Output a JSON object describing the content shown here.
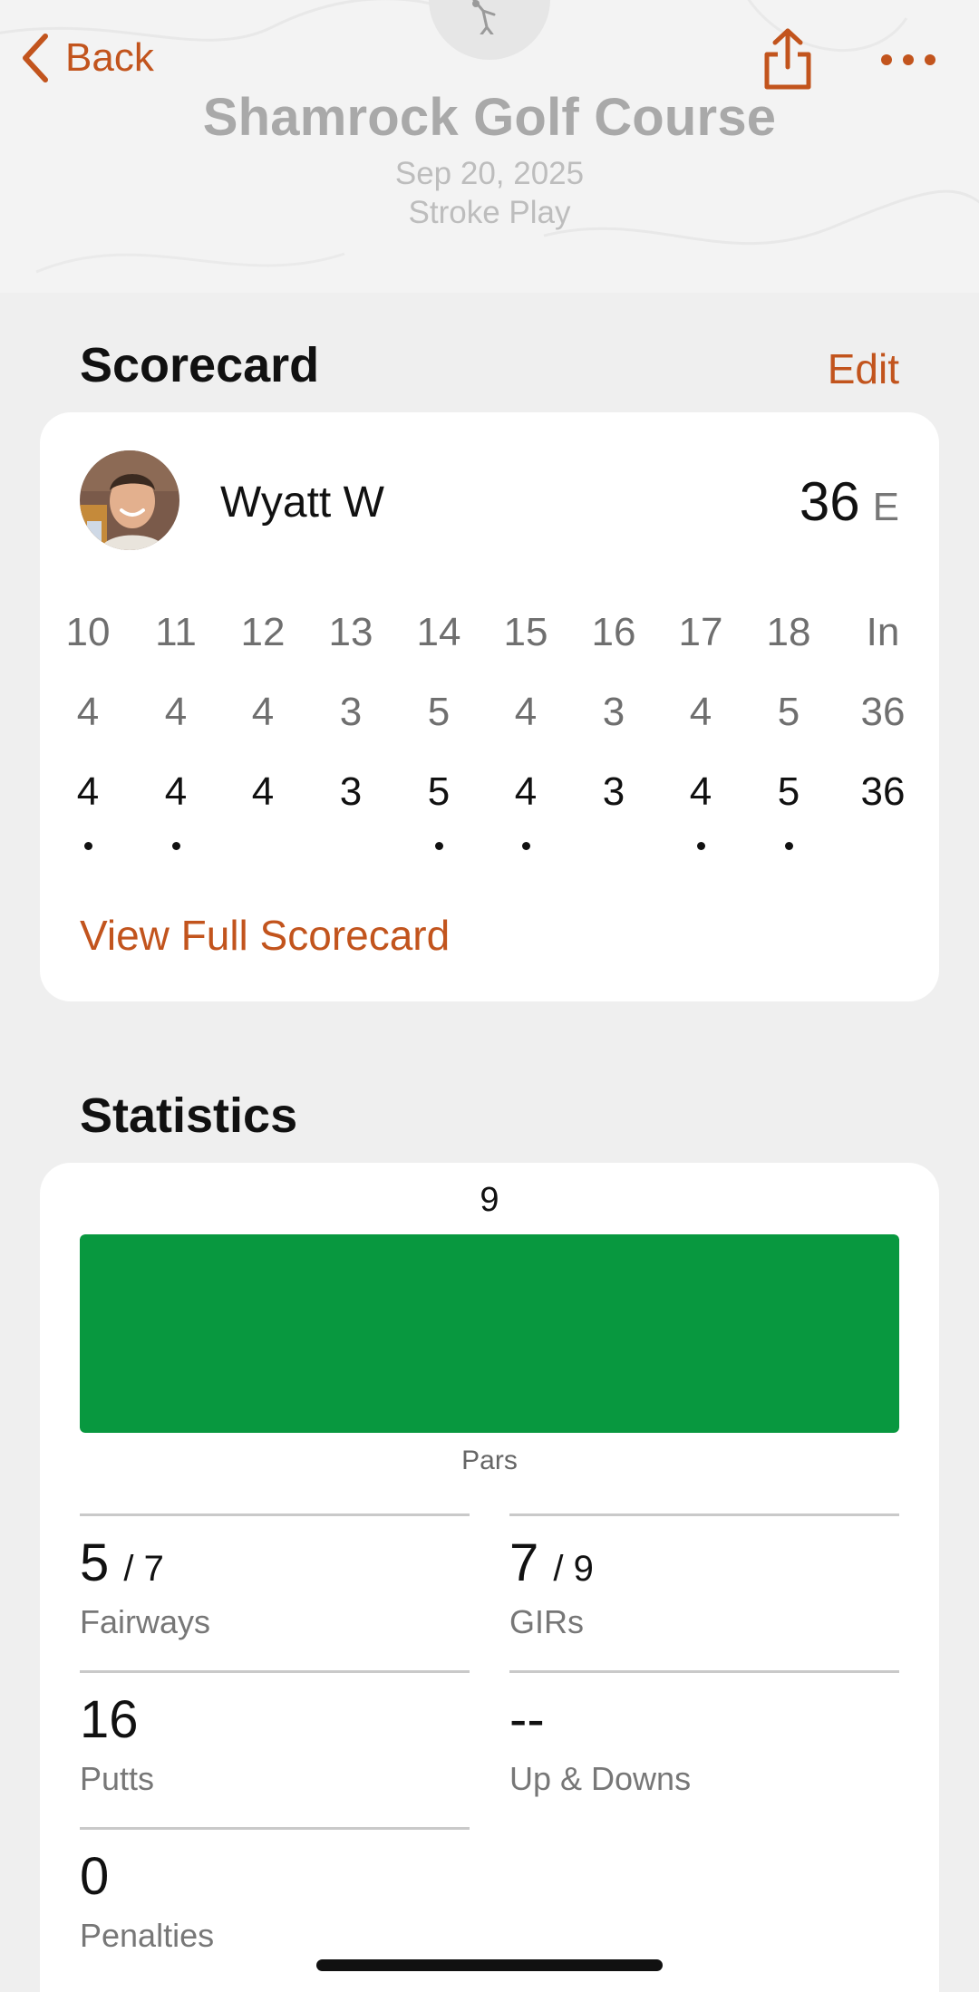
{
  "header": {
    "back_label": "Back",
    "course_name": "Shamrock Golf Course",
    "date": "Sep 20, 2025",
    "format": "Stroke Play",
    "icons": {
      "back": "chevron-left-icon",
      "share": "share-icon",
      "more": "ellipsis-icon",
      "logo": "golfer-icon"
    }
  },
  "scorecard": {
    "title": "Scorecard",
    "edit_label": "Edit",
    "player": {
      "name": "Wyatt W",
      "total": "36",
      "relative_to_par": "E"
    },
    "holes": [
      "10",
      "11",
      "12",
      "13",
      "14",
      "15",
      "16",
      "17",
      "18",
      "In"
    ],
    "pars": [
      "4",
      "4",
      "4",
      "3",
      "5",
      "4",
      "3",
      "4",
      "5",
      "36"
    ],
    "scores": [
      "4",
      "4",
      "4",
      "3",
      "5",
      "4",
      "3",
      "4",
      "5",
      "36"
    ],
    "dotted_holes": [
      "10",
      "11",
      "14",
      "15",
      "17",
      "18"
    ],
    "view_full_label": "View Full Scorecard"
  },
  "statistics": {
    "title": "Statistics",
    "bar": {
      "value": "9",
      "label": "Pars",
      "fraction": 1.0,
      "color": "#08983f"
    },
    "fairways": {
      "value": "5",
      "of": "/ 7",
      "label": "Fairways"
    },
    "girs": {
      "value": "7",
      "of": "/ 9",
      "label": "GIRs"
    },
    "putts": {
      "value": "16",
      "label": "Putts"
    },
    "up_downs": {
      "value": "--",
      "label": "Up & Downs"
    },
    "penalties": {
      "value": "0",
      "label": "Penalties"
    }
  },
  "colors": {
    "accent": "#c2541d",
    "par_green": "#08983f"
  }
}
